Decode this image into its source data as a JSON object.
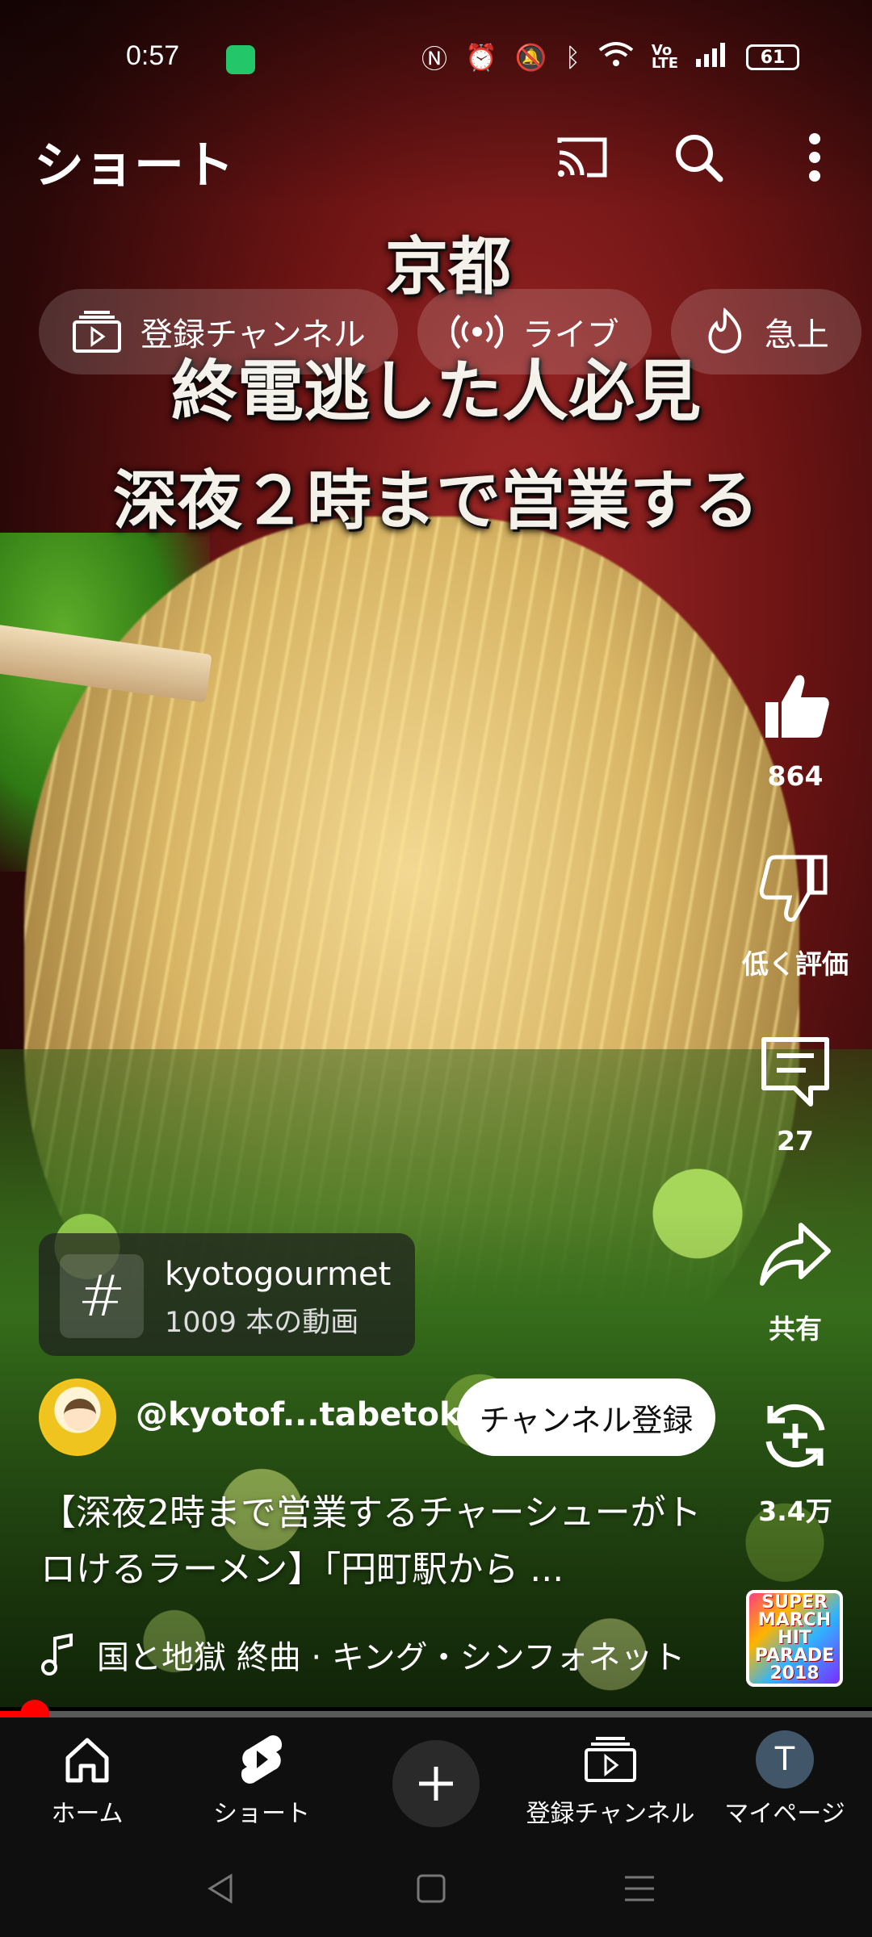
{
  "status_bar": {
    "time": "0:57",
    "battery": "61"
  },
  "header": {
    "title": "ショート"
  },
  "chips": [
    {
      "label": "登録チャンネル",
      "icon": "subscriptions-icon"
    },
    {
      "label": "ライブ",
      "icon": "live-icon"
    },
    {
      "label": "急上",
      "icon": "trending-icon"
    }
  ],
  "video_caption": {
    "line1": "京都",
    "line2": "終電逃した人必見",
    "line3": "深夜２時まで営業する"
  },
  "actions": {
    "like_count": "864",
    "dislike_label": "低く評価",
    "comment_count": "27",
    "share_label": "共有",
    "remix_count": "3.4万"
  },
  "hashtag": {
    "name": "kyotogourmet",
    "video_count": "1009 本の動画"
  },
  "channel": {
    "handle": "@kyotof...tabetoku",
    "subscribe_label": "チャンネル登録"
  },
  "description": "【深夜2時まで営業するチャーシューがトロけるラーメン】「円町駅から ...",
  "music": {
    "track": "国と地獄 終曲 · キング・シンフォネット"
  },
  "album_art": {
    "text": "SUPER MARCH HIT PARADE 2018"
  },
  "progress": {
    "fraction": 0.04
  },
  "nav": [
    {
      "label": "ホーム",
      "icon": "home-icon"
    },
    {
      "label": "ショート",
      "icon": "shorts-icon"
    },
    {
      "label": "",
      "icon": "create-icon"
    },
    {
      "label": "登録チャンネル",
      "icon": "subscriptions-icon"
    },
    {
      "label": "マイページ",
      "icon": "avatar",
      "avatar_letter": "T"
    }
  ]
}
